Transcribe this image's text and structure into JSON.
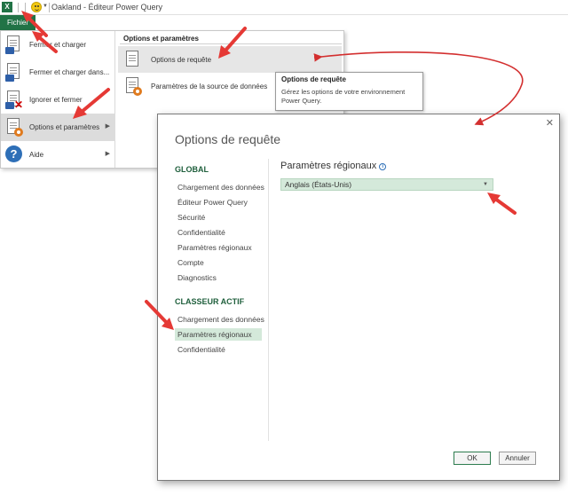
{
  "titlebar": {
    "app_icon_label": "X",
    "window_title": "Oakland - Éditeur Power Query"
  },
  "ribbon": {
    "file_tab": "Fichier"
  },
  "file_menu": {
    "items": [
      {
        "label": "Fermer et charger",
        "icon": "close-and-load-icon"
      },
      {
        "label": "Fermer et charger dans...",
        "icon": "close-and-load-to-icon"
      },
      {
        "label": "Ignorer et fermer",
        "icon": "discard-and-close-icon"
      },
      {
        "label": "Options et paramètres",
        "icon": "options-gear-icon"
      },
      {
        "label": "Aide",
        "icon": "help-icon"
      }
    ],
    "submenu": {
      "header": "Options et paramètres",
      "items": [
        {
          "label": "Options de requête",
          "icon": "query-options-icon"
        },
        {
          "label": "Paramètres de la source de données",
          "icon": "data-source-settings-icon"
        }
      ]
    }
  },
  "tooltip": {
    "title": "Options de requête",
    "body": "Gérez les options de votre environnement Power Query."
  },
  "dialog": {
    "title": "Options de requête",
    "close_glyph": "✕",
    "global_header": "GLOBAL",
    "global_items": [
      "Chargement des données",
      "Éditeur Power Query",
      "Sécurité",
      "Confidentialité",
      "Paramètres régionaux",
      "Compte",
      "Diagnostics"
    ],
    "workbook_header": "CLASSEUR ACTIF",
    "workbook_items": [
      "Chargement des données",
      "Paramètres régionaux",
      "Confidentialité"
    ],
    "selected_item": "Paramètres régionaux",
    "section_title": "Paramètres régionaux",
    "locale_value": "Anglais (États-Unis)",
    "ok_label": "OK",
    "cancel_label": "Annuler"
  },
  "annotations": {
    "arrow_color": "#e53935",
    "curve_color": "#d32f2f"
  },
  "colors": {
    "excel_green": "#217346",
    "selection_green": "#d4e9da",
    "section_green": "#1f5f3c"
  }
}
